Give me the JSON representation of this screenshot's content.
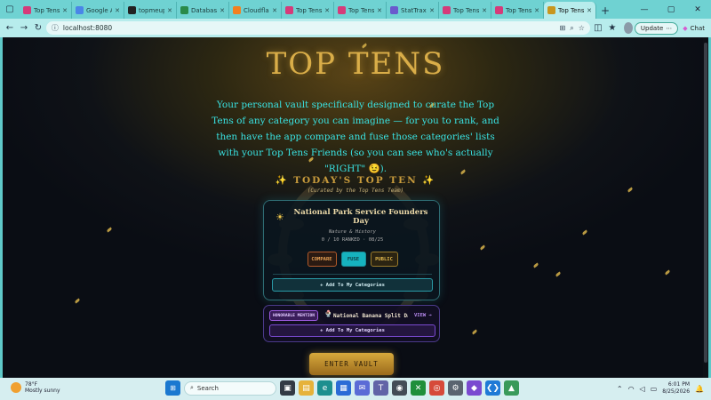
{
  "browser": {
    "tabs": [
      {
        "label": "Top Tens F",
        "color": "#d53b7a",
        "active": false
      },
      {
        "label": "Google Ai",
        "color": "#4a86e8",
        "active": false
      },
      {
        "label": "topmeup",
        "color": "#222222",
        "active": false
      },
      {
        "label": "Database",
        "color": "#2a8a4a",
        "active": false
      },
      {
        "label": "CloudflareI",
        "color": "#f38020",
        "active": false
      },
      {
        "label": "Top Tens",
        "color": "#d53b7a",
        "active": false
      },
      {
        "label": "Top Tens",
        "color": "#d53b7a",
        "active": false
      },
      {
        "label": "StatTrax",
        "color": "#6a5acd",
        "active": false
      },
      {
        "label": "Top Tens",
        "color": "#d53b7a",
        "active": false
      },
      {
        "label": "Top Tens",
        "color": "#d53b7a",
        "active": false
      },
      {
        "label": "Top Tens —",
        "color": "#c8961e",
        "active": true
      }
    ],
    "url": "localhost:8080",
    "update_label": "Update",
    "chat_label": "Chat"
  },
  "page": {
    "title": "TOP TENS",
    "intro": "Your personal vault specifically designed to curate the Top Tens of any category you can imagine — for you to rank, and then have the app compare and fuse those categories' lists with your Top Tens Friends (so you can see who's actually \"RIGHT\" 😉).",
    "todays_heading": "✨ TODAY'S TOP TEN ✨",
    "curated": "(Curated by the Top Tens Team)",
    "feature": {
      "title": "National Park Service Founders Day",
      "category": "Nature & History",
      "stats": "0 / 10 RANKED · 08/25",
      "compare": "COMPARE",
      "fuse": "FUSE",
      "public": "PUBLIC",
      "add": "+ Add To My Categories"
    },
    "honorable": {
      "badge": "HONORABLE MENTION",
      "title": "National Banana Split Day",
      "view": "VIEW →",
      "add": "+ Add To My Categories"
    },
    "enter": "ENTER VAULT"
  },
  "taskbar": {
    "temp": "78°F",
    "weather": "Mostly sunny",
    "search": "Search",
    "time": "6:01 PM",
    "date": "8/25/2026"
  }
}
